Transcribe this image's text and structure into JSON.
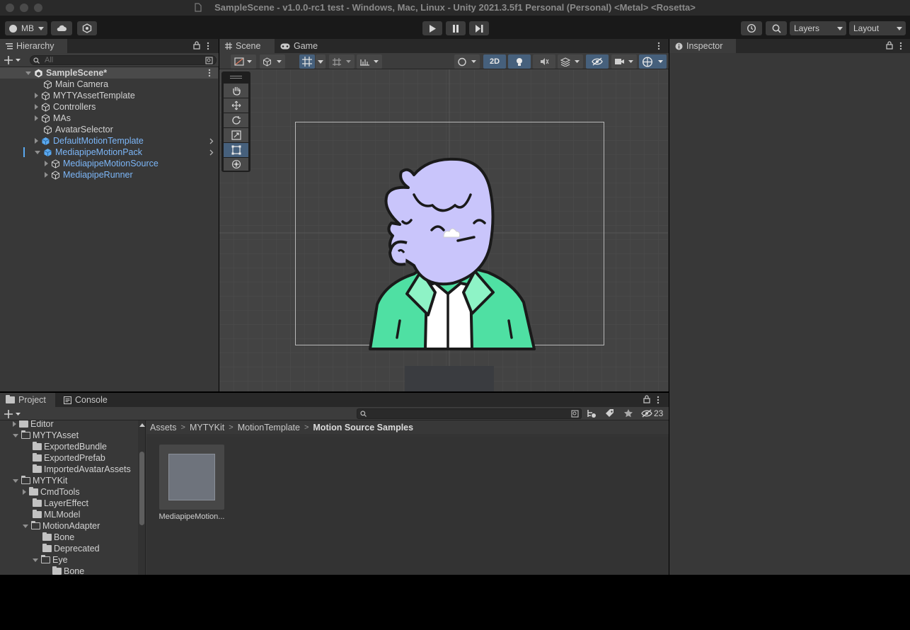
{
  "window": {
    "title": "SampleScene - v1.0.0-rc1 test - Windows, Mac, Linux - Unity 2021.3.5f1 Personal (Personal) <Metal> <Rosetta>"
  },
  "toolbar": {
    "account_label": "MB",
    "layers_label": "Layers",
    "layout_label": "Layout"
  },
  "hierarchy": {
    "tab_label": "Hierarchy",
    "search_placeholder": "All",
    "scene_name": "SampleScene*",
    "items": [
      {
        "label": "Main Camera"
      },
      {
        "label": "MYTYAssetTemplate"
      },
      {
        "label": "Controllers"
      },
      {
        "label": "MAs"
      },
      {
        "label": "AvatarSelector"
      },
      {
        "label": "DefaultMotionTemplate"
      },
      {
        "label": "MediapipeMotionPack"
      },
      {
        "label": "MediapipeMotionSource"
      },
      {
        "label": "MediapipeRunner"
      }
    ]
  },
  "scene": {
    "tab_scene": "Scene",
    "tab_game": "Game",
    "mode_2d": "2D"
  },
  "inspector": {
    "tab_label": "Inspector"
  },
  "project": {
    "tab_project": "Project",
    "tab_console": "Console",
    "hidden_count": "23",
    "breadcrumb": [
      "Assets",
      "MYTYKit",
      "MotionTemplate",
      "Motion Source Samples"
    ],
    "tree": [
      {
        "label": "Editor"
      },
      {
        "label": "MYTYAsset"
      },
      {
        "label": "ExportedBundle"
      },
      {
        "label": "ExportedPrefab"
      },
      {
        "label": "ImportedAvatarAssets"
      },
      {
        "label": "MYTYKit"
      },
      {
        "label": "CmdTools"
      },
      {
        "label": "LayerEffect"
      },
      {
        "label": "MLModel"
      },
      {
        "label": "MotionAdapter"
      },
      {
        "label": "Bone"
      },
      {
        "label": "Deprecated"
      },
      {
        "label": "Eye"
      },
      {
        "label": "Bone"
      }
    ],
    "asset_name": "MediapipeMotion..."
  },
  "colors": {
    "selection_blue": "#7cb6f7",
    "active_tool": "#46607c",
    "character_skin": "#c9c5fb",
    "jacket_green": "#4fe0a3"
  }
}
